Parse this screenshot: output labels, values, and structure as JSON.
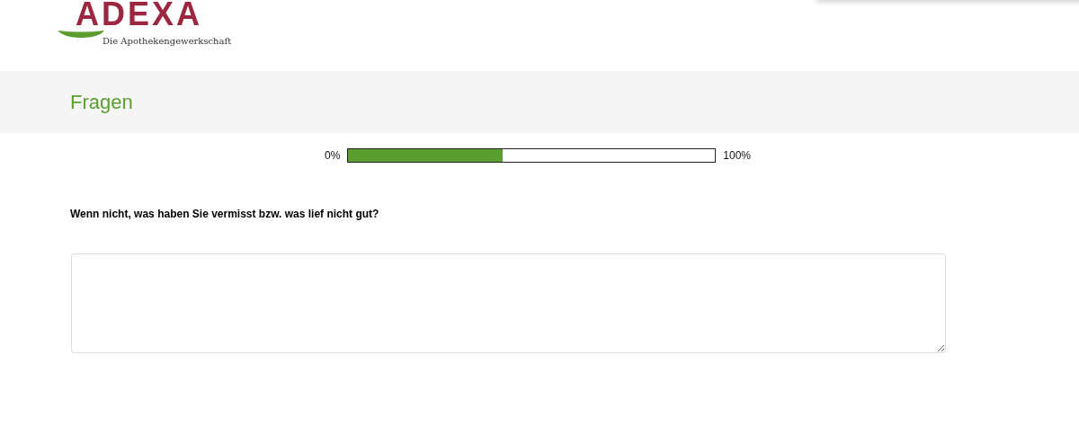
{
  "logo": {
    "name": "ADEXA",
    "tagline": "Die Apothekengewerkschaft"
  },
  "page_title": "Fragen",
  "progress": {
    "start_label": "0%",
    "end_label": "100%",
    "level": 0.42
  },
  "question": {
    "text": "Wenn nicht, was haben Sie vermisst bzw. was lief nicht gut?"
  }
}
